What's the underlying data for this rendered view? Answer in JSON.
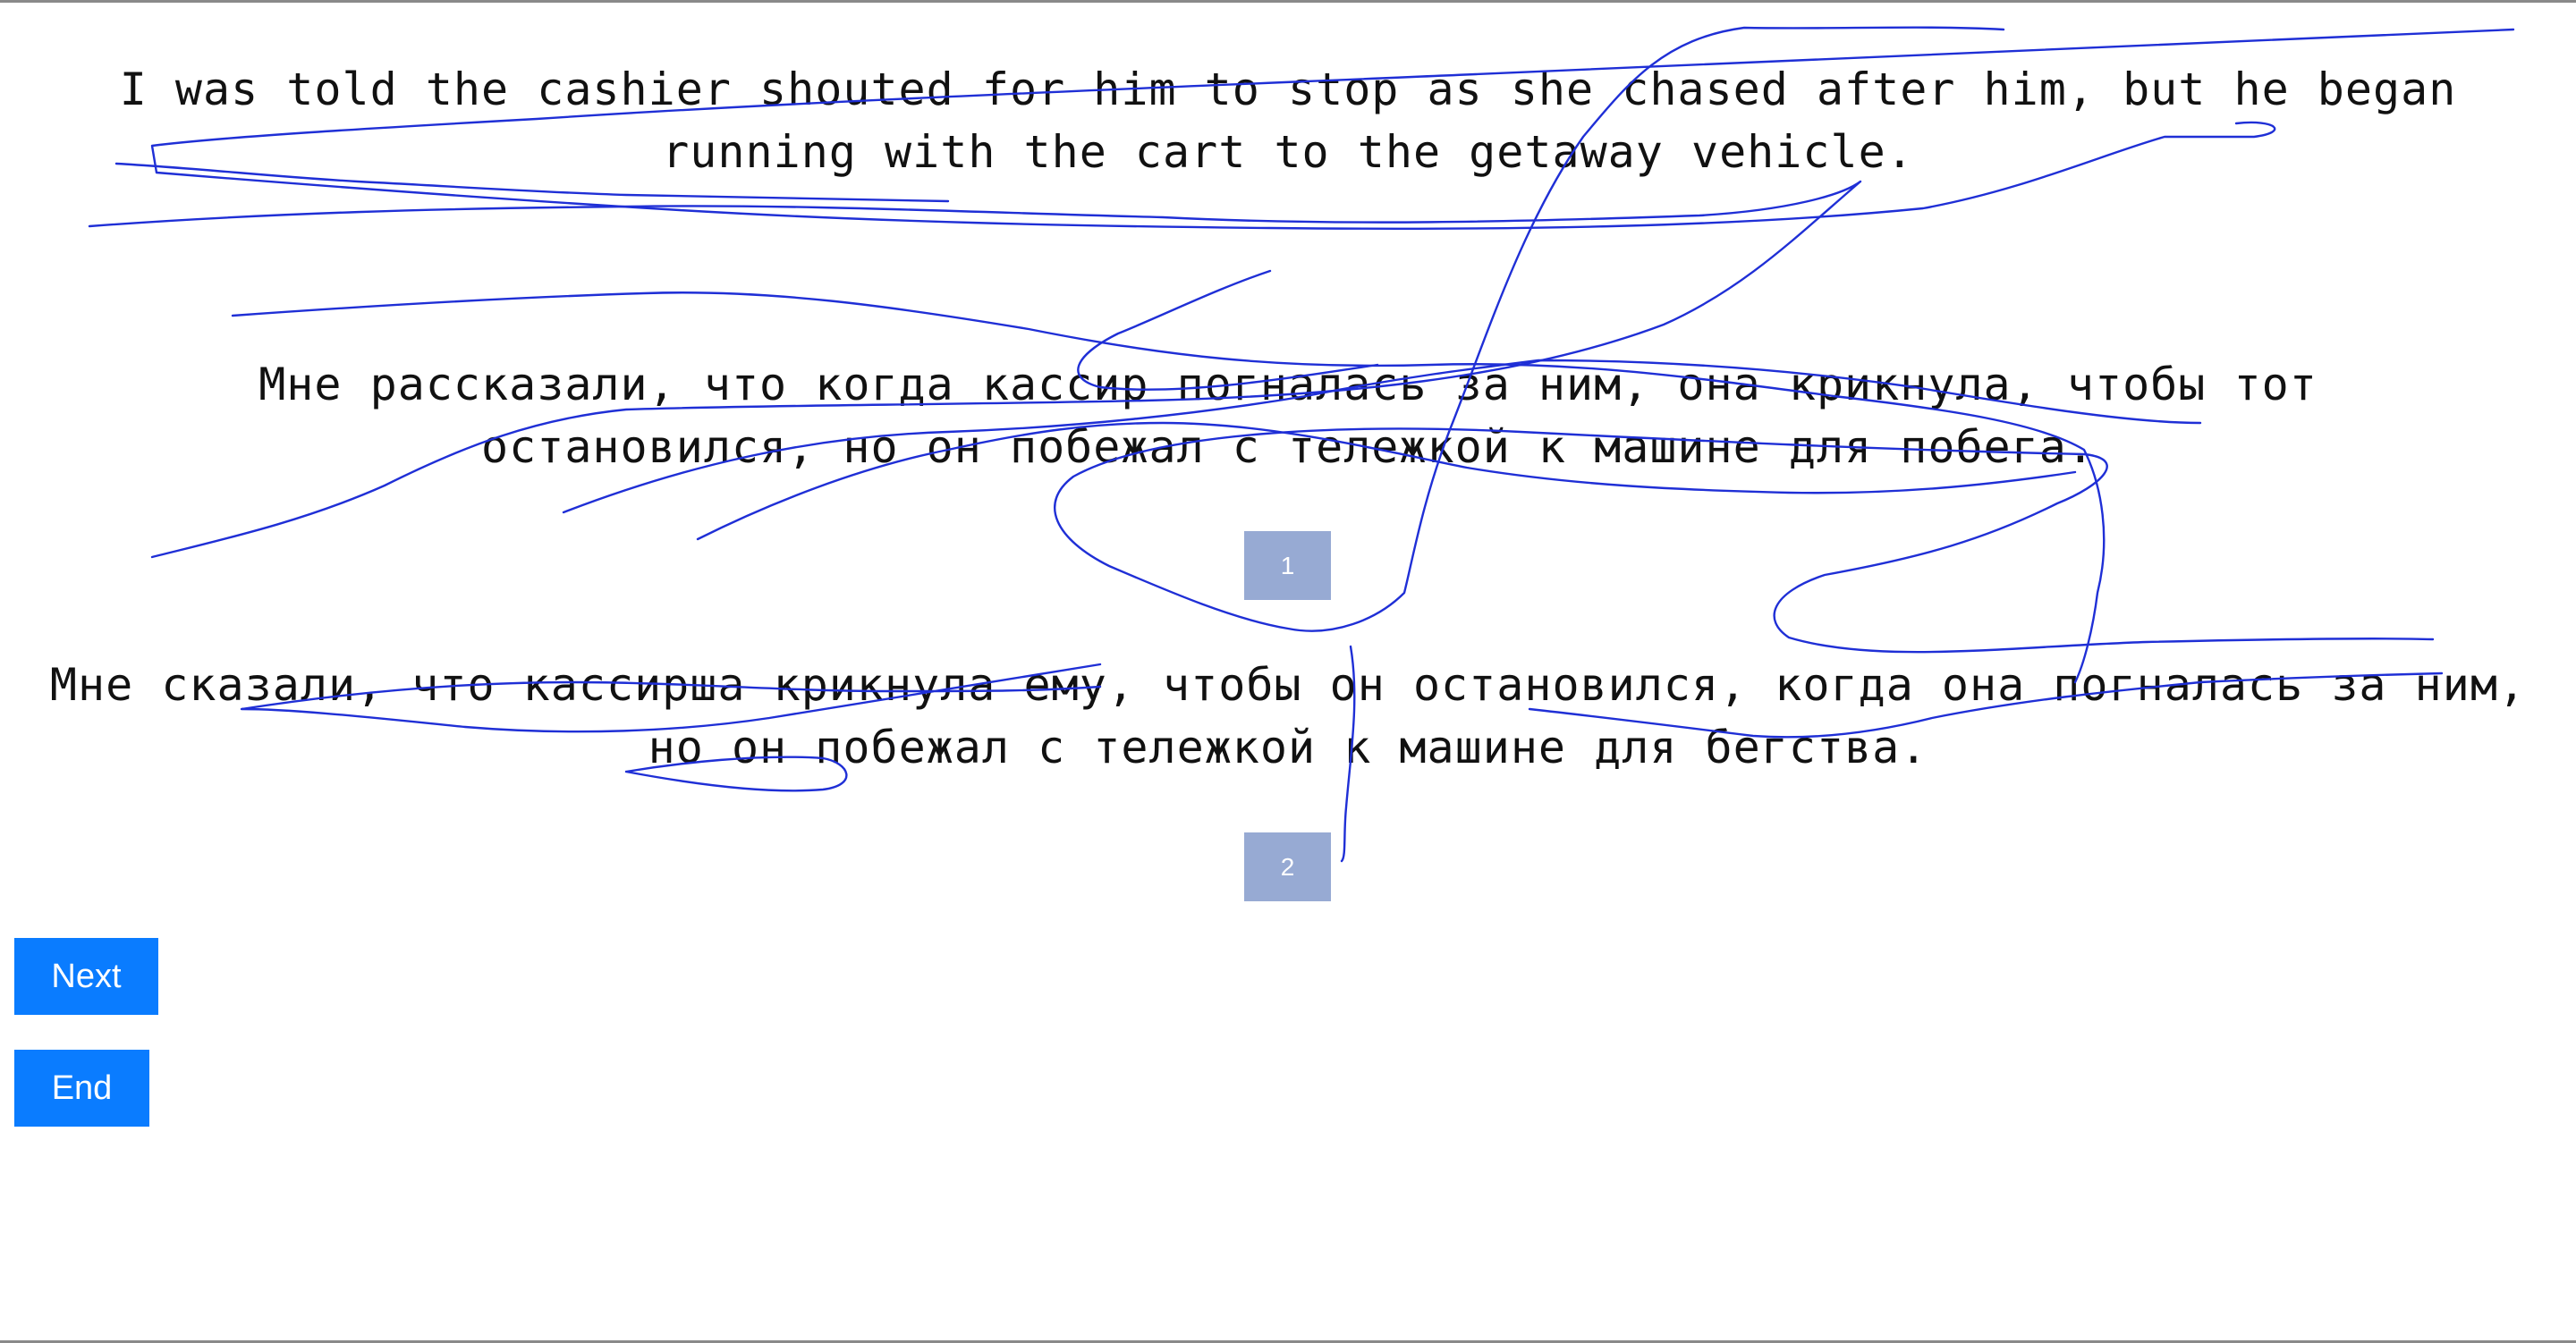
{
  "source_sentence": "I was told the cashier shouted for him to stop as she chased after him, but he began running with the cart to the getaway vehicle.",
  "translations": [
    {
      "text": "Мне рассказали, что когда кассир погналась за ним, она крикнула, чтобы тот остановился, но он побежал с тележкой к машине для побега.",
      "choice_label": "1"
    },
    {
      "text": "Мне сказали, что кассирша крикнула ему, чтобы он остановился, когда она погналась за ним, но он побежал с тележкой к машине для бегства.",
      "choice_label": "2"
    }
  ],
  "buttons": {
    "next": "Next",
    "end": "End"
  },
  "colors": {
    "choice_button": "#97aad3",
    "nav_button": "#0a7cff",
    "scribble_stroke": "#1f2fd6"
  }
}
